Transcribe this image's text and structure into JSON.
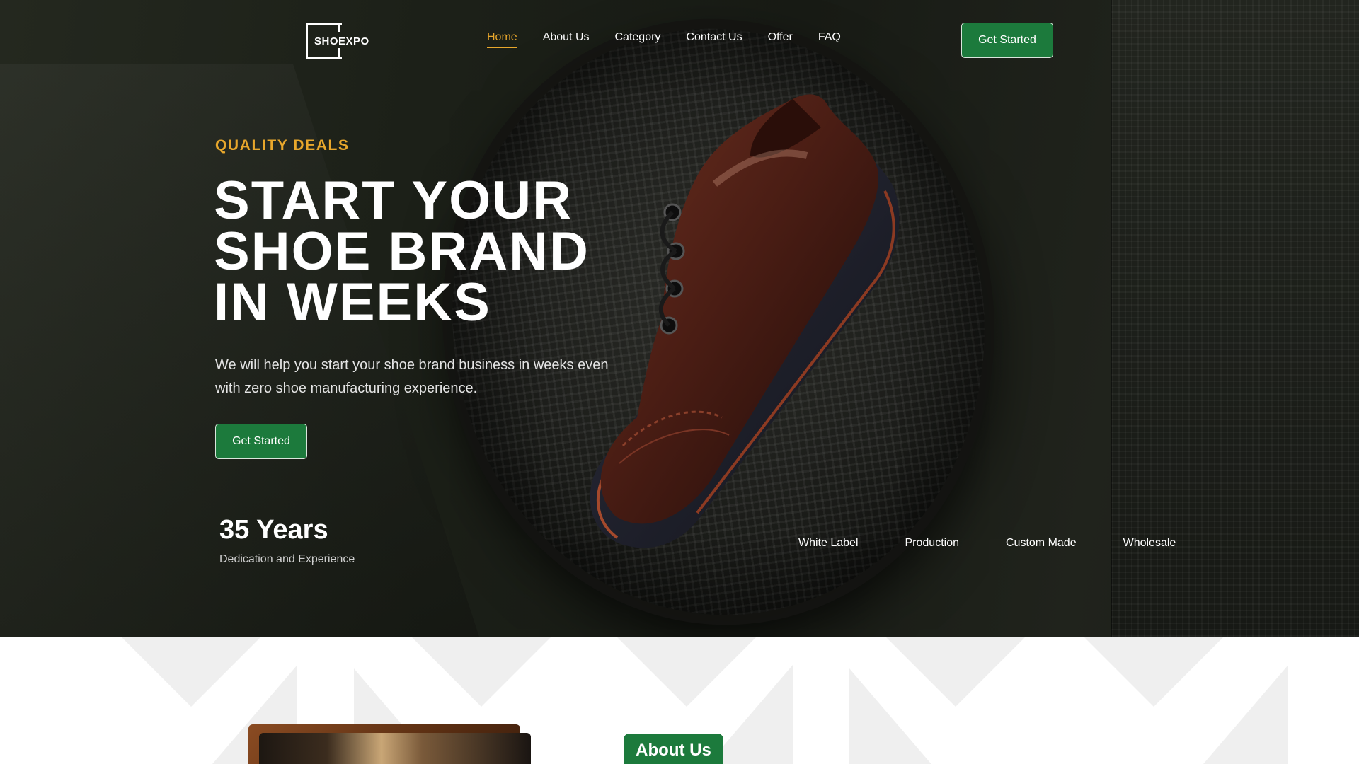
{
  "brand": {
    "logo_text": "SHOEXPO"
  },
  "nav": {
    "items": [
      {
        "label": "Home",
        "active": true
      },
      {
        "label": "About Us"
      },
      {
        "label": "Category"
      },
      {
        "label": "Contact Us"
      },
      {
        "label": "Offer"
      },
      {
        "label": "FAQ"
      }
    ]
  },
  "header": {
    "cta_label": "Get Started"
  },
  "hero": {
    "eyebrow": "QUALITY DEALS",
    "headline_lines": [
      "START YOUR",
      "SHOE BRAND",
      "IN WEEKS"
    ],
    "subtext": "We will help you start your shoe brand business in weeks even with zero shoe manufacturing experience.",
    "cta_label": "Get Started",
    "stat_value": "35 Years",
    "stat_label": "Dedication and Experience",
    "services": [
      "White Label",
      "Production",
      "Custom Made",
      "Wholesale"
    ]
  },
  "about": {
    "badge": "About Us"
  },
  "colors": {
    "accent": "#e8a72c",
    "primary_green": "#1c7a3c",
    "hero_bg": "#1c2018"
  },
  "icons": {
    "hero_image": "shoe-photo",
    "logo": "shoexpo-logo"
  }
}
